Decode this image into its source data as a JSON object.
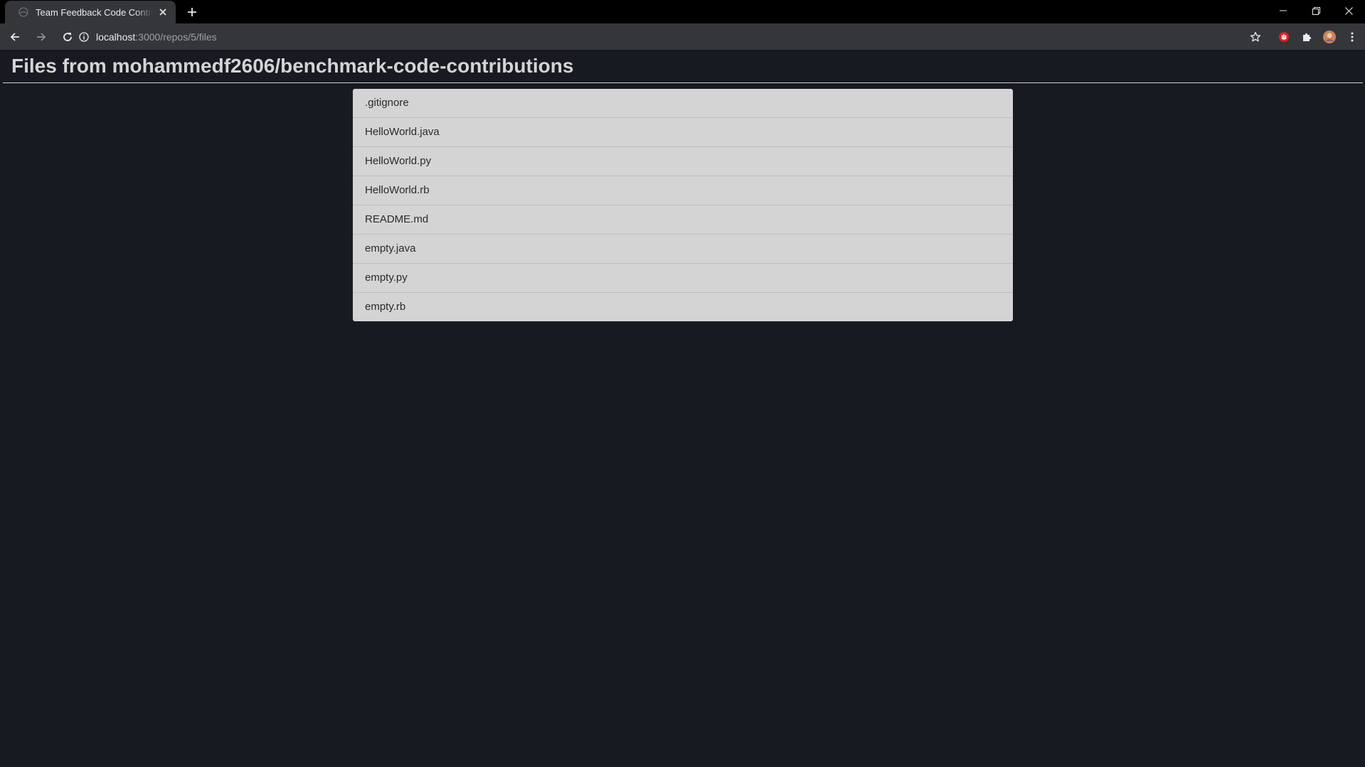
{
  "browser": {
    "tab": {
      "title": "Team Feedback Code Contributions",
      "favicon": "globe-icon"
    },
    "address": {
      "host": "localhost",
      "path": ":3000/repos/5/files"
    },
    "colors": {
      "tabstrip": "#000000",
      "toolbar": "#35363a",
      "page_background": "#171a21",
      "list_item_background": "#d4d4d4",
      "extension_accent": "#e02020"
    }
  },
  "page": {
    "title": "Files from mohammedf2606/benchmark-code-contributions",
    "files": [
      ".gitignore",
      "HelloWorld.java",
      "HelloWorld.py",
      "HelloWorld.rb",
      "README.md",
      "empty.java",
      "empty.py",
      "empty.rb"
    ]
  }
}
